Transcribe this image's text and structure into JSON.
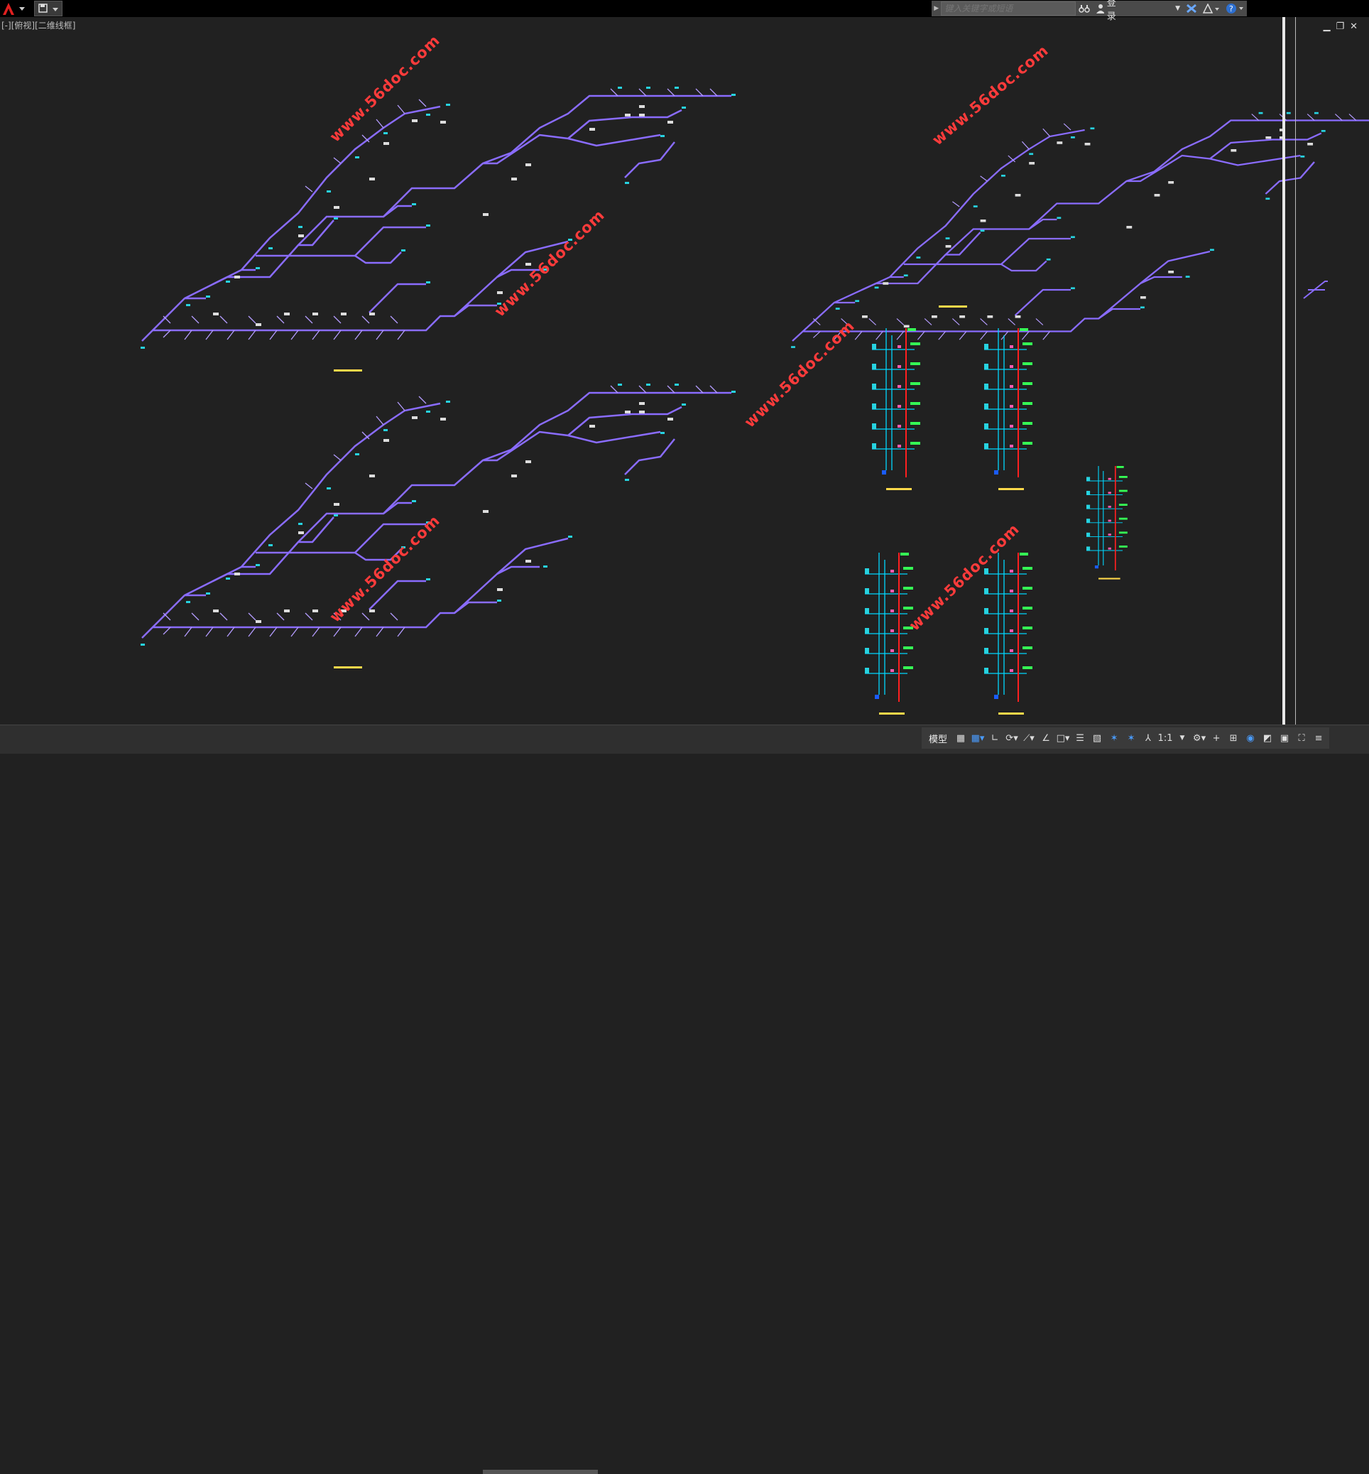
{
  "titlebar": {
    "search_placeholder": "键入关键字或短语",
    "login_label": "登录"
  },
  "viewport": {
    "label": "[-][俯视][二维线框]"
  },
  "watermarks": [
    "www.56doc.com",
    "www.56doc.com",
    "www.56doc.com",
    "www.56doc.com",
    "www.56doc.com",
    "www.56doc.com"
  ],
  "statusbar": {
    "model_tab": "模型",
    "scale": "1:1"
  },
  "colors": {
    "pipe": "#8a6cff",
    "riser_red": "#ff2020",
    "riser_cyan": "#00d8ff",
    "label_green": "#35ff55",
    "fixture_cyan": "#27d3e0",
    "watermark": "#ff3b3b",
    "label_yellow": "#ffd84a"
  }
}
